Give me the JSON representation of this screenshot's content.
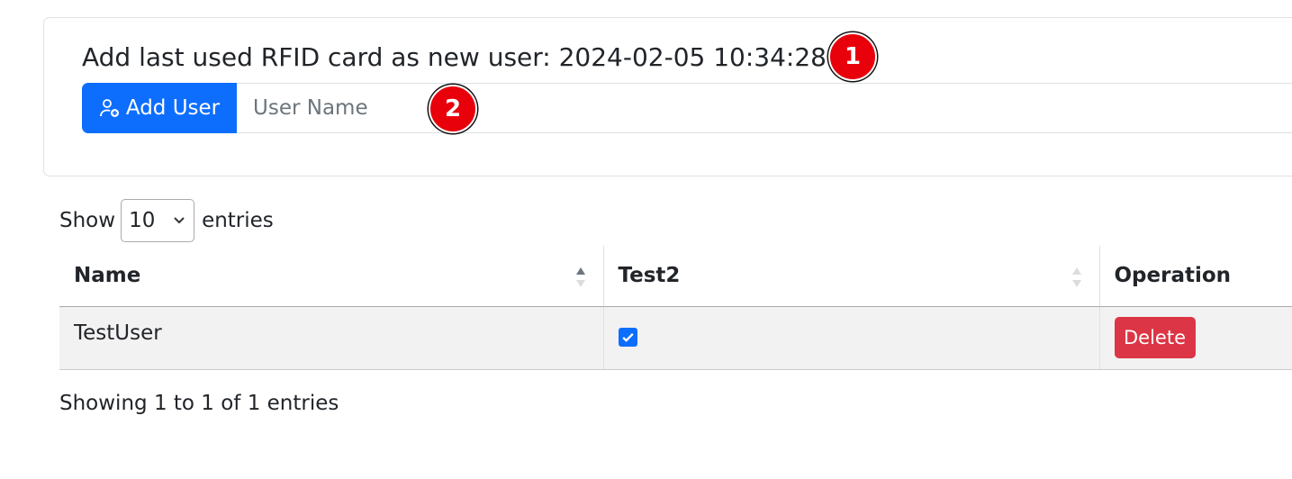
{
  "header": {
    "title": "Add last used RFID card as new user: 2024-02-05 10:34:28",
    "marker_1": "1",
    "marker_2": "2"
  },
  "form": {
    "add_button_label": "Add User",
    "name_placeholder": "User Name",
    "name_value": ""
  },
  "length": {
    "show_label": "Show",
    "selected": "10",
    "entries_label": "entries"
  },
  "table": {
    "columns": [
      "Name",
      "Test2",
      "Operation"
    ],
    "rows": [
      {
        "name": "TestUser",
        "test2_checked": true,
        "operation_label": "Delete"
      }
    ]
  },
  "info": "Showing 1 to 1 of 1 entries",
  "colors": {
    "primary": "#0d6efd",
    "danger": "#dc3545",
    "marker": "#e8000b"
  }
}
